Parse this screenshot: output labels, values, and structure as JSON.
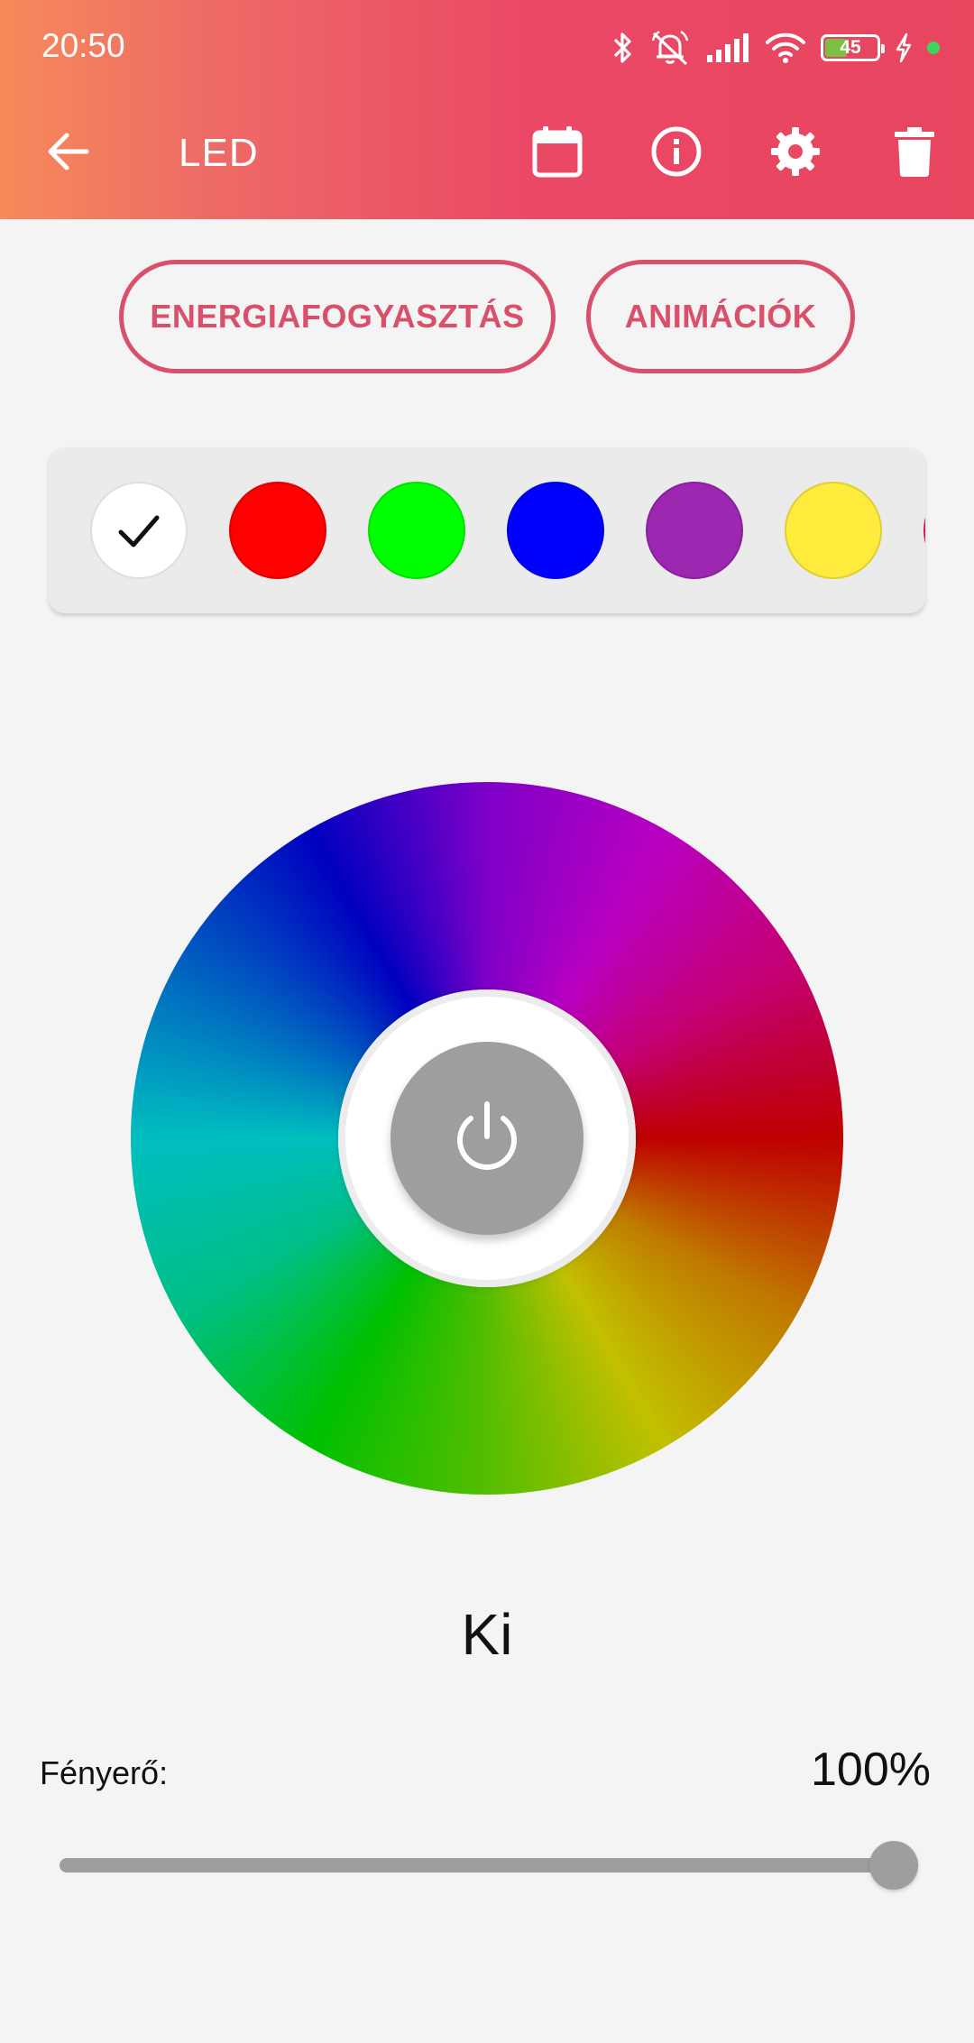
{
  "status_bar": {
    "time": "20:50",
    "battery_level": "45",
    "icons": [
      "bluetooth-icon",
      "muted-alarm-icon",
      "signal-icon",
      "wifi-icon",
      "battery-icon",
      "charging-icon"
    ]
  },
  "header": {
    "title": "LED",
    "back_icon": "arrow-left-icon",
    "actions": [
      "calendar-icon",
      "info-icon",
      "gear-icon",
      "trash-icon"
    ]
  },
  "buttons": {
    "energy": "ENERGIAFOGYASZTÁS",
    "animations": "ANIMÁCIÓK"
  },
  "palette": {
    "selected_index": 0,
    "colors": [
      "#ffffff",
      "#ff0000",
      "#00ff00",
      "#0000ff",
      "#9c27b0",
      "#ffeb3b",
      "#e91e63"
    ]
  },
  "state": {
    "label": "Ki"
  },
  "brightness": {
    "label": "Fényerő:",
    "value_text": "100%",
    "value": 1.0
  },
  "colors": {
    "accent": "#d9506a",
    "header_start": "#f58a5a",
    "header_end": "#e8455f",
    "control_gray": "#9e9e9e"
  }
}
